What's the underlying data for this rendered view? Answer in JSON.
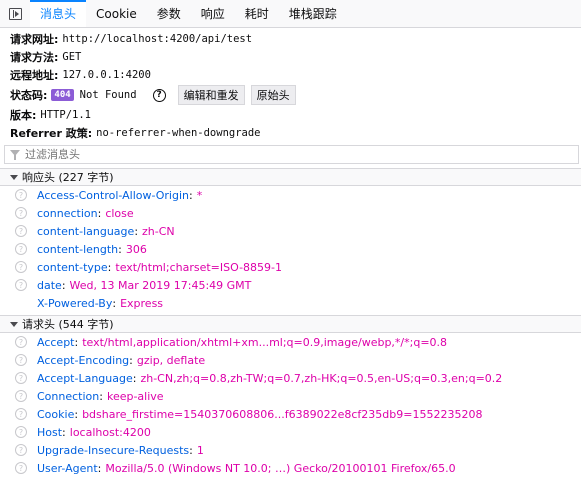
{
  "tabs": [
    {
      "label": "消息头",
      "active": true
    },
    {
      "label": "Cookie",
      "active": false
    },
    {
      "label": "参数",
      "active": false
    },
    {
      "label": "响应",
      "active": false
    },
    {
      "label": "耗时",
      "active": false
    },
    {
      "label": "堆栈跟踪",
      "active": false
    }
  ],
  "summary": {
    "url_label": "请求网址:",
    "url_value": "http://localhost:4200/api/test",
    "method_label": "请求方法:",
    "method_value": "GET",
    "remote_label": "远程地址:",
    "remote_value": "127.0.0.1:4200",
    "status_label": "状态码:",
    "status_code": "404",
    "status_text": "Not Found",
    "help_icon": "?",
    "edit_resend": "编辑和重发",
    "raw_headers": "原始头",
    "version_label": "版本:",
    "version_value": "HTTP/1.1",
    "referrer_label": "Referrer 政策:",
    "referrer_value": "no-referrer-when-downgrade"
  },
  "filter": {
    "placeholder": "过滤消息头"
  },
  "response": {
    "title": "响应头 (227 字节)",
    "headers": [
      {
        "name": "Access-Control-Allow-Origin",
        "value": "*",
        "help": true
      },
      {
        "name": "connection",
        "value": "close",
        "help": true
      },
      {
        "name": "content-language",
        "value": "zh-CN",
        "help": true
      },
      {
        "name": "content-length",
        "value": "306",
        "help": true
      },
      {
        "name": "content-type",
        "value": "text/html;charset=ISO-8859-1",
        "help": true
      },
      {
        "name": "date",
        "value": "Wed, 13 Mar 2019 17:45:49 GMT",
        "help": true
      },
      {
        "name": "X-Powered-By",
        "value": "Express",
        "help": false
      }
    ]
  },
  "request": {
    "title": "请求头 (544 字节)",
    "headers": [
      {
        "name": "Accept",
        "value": "text/html,application/xhtml+xm...ml;q=0.9,image/webp,*/*;q=0.8",
        "help": true
      },
      {
        "name": "Accept-Encoding",
        "value": "gzip, deflate",
        "help": true
      },
      {
        "name": "Accept-Language",
        "value": "zh-CN,zh;q=0.8,zh-TW;q=0.7,zh-HK;q=0.5,en-US;q=0.3,en;q=0.2",
        "help": true
      },
      {
        "name": "Connection",
        "value": "keep-alive",
        "help": true
      },
      {
        "name": "Cookie",
        "value": "bdshare_firstime=1540370608806...f6389022e8cf235db9=1552235208",
        "help": true
      },
      {
        "name": "Host",
        "value": "localhost:4200",
        "help": true
      },
      {
        "name": "Upgrade-Insecure-Requests",
        "value": "1",
        "help": true
      },
      {
        "name": "User-Agent",
        "value": "Mozilla/5.0 (Windows NT 10.0; …) Gecko/20100101 Firefox/65.0",
        "help": true
      }
    ]
  }
}
